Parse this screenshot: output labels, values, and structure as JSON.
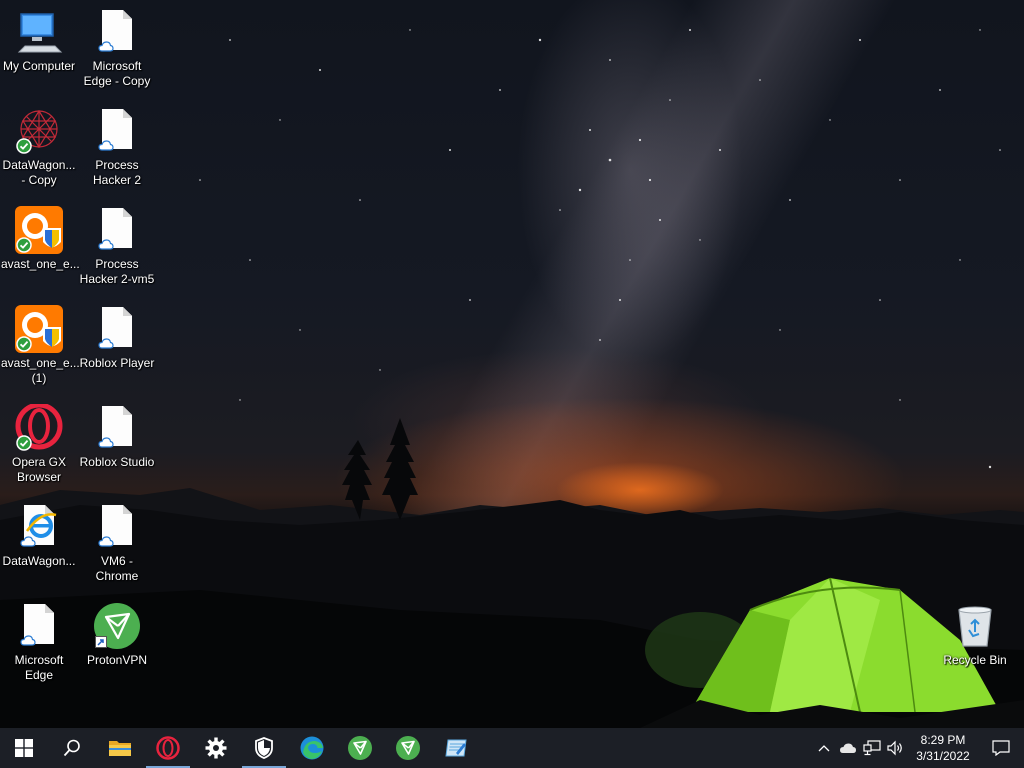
{
  "desktop": {
    "icons": [
      {
        "label": "My Computer"
      },
      {
        "label": "DataWagon... - Copy"
      },
      {
        "label": "avast_one_e..."
      },
      {
        "label": "avast_one_e... (1)"
      },
      {
        "label": "Opera GX Browser"
      },
      {
        "label": "DataWagon..."
      },
      {
        "label": "Microsoft Edge"
      },
      {
        "label": "Microsoft Edge - Copy"
      },
      {
        "label": "Process Hacker 2"
      },
      {
        "label": "Process Hacker 2-vm5"
      },
      {
        "label": "Roblox Player"
      },
      {
        "label": "Roblox Studio"
      },
      {
        "label": "VM6 - Chrome"
      },
      {
        "label": "ProtonVPN"
      },
      {
        "label": "Recycle Bin"
      }
    ]
  },
  "taskbar": {
    "start_icon": "windows-logo-icon",
    "search_icon": "search-icon",
    "pinned": [
      {
        "name": "file-explorer-icon"
      },
      {
        "name": "opera-gx-icon"
      },
      {
        "name": "settings-gear-icon"
      },
      {
        "name": "windows-security-shield-icon"
      },
      {
        "name": "microsoft-edge-icon"
      },
      {
        "name": "protonvpn-icon"
      },
      {
        "name": "protonvpn-icon"
      },
      {
        "name": "notepad-icon"
      }
    ],
    "tray": {
      "time": "8:29 PM",
      "date": "3/31/2022"
    }
  },
  "colors": {
    "taskbar_bg": "#1c1f26",
    "active_indicator": "#7aa7d8",
    "protonvpn_green": "#4caf50",
    "tent_green": "#8bdc2e"
  }
}
